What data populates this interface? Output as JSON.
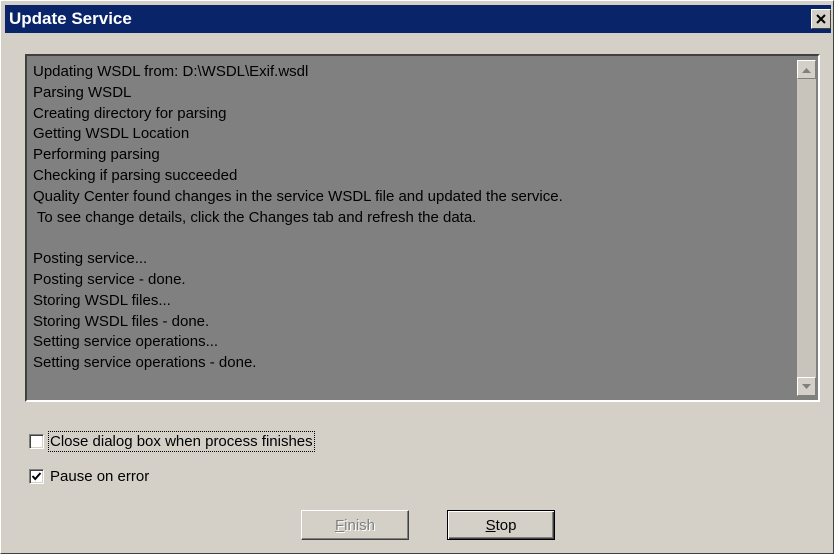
{
  "window": {
    "title": "Update Service",
    "close_icon": "close-icon"
  },
  "log": {
    "lines": [
      "Updating WSDL from: D:\\WSDL\\Exif.wsdl",
      "Parsing WSDL",
      "Creating directory for parsing",
      "Getting WSDL Location",
      "Performing parsing",
      "Checking if parsing succeeded",
      "Quality Center found changes in the service WSDL file and updated the service.",
      " To see change details, click the Changes tab and refresh the data.",
      "",
      "Posting service...",
      "Posting service - done.",
      "Storing WSDL files...",
      "Storing WSDL files - done.",
      "Setting service operations...",
      "Setting service operations - done."
    ]
  },
  "options": {
    "close_when_finished": {
      "label": "Close dialog box when process finishes",
      "checked": false
    },
    "pause_on_error": {
      "label": "Pause on error",
      "checked": true
    }
  },
  "buttons": {
    "finish": {
      "mnemonic": "F",
      "rest": "inish",
      "enabled": false
    },
    "stop": {
      "mnemonic": "S",
      "rest": "top",
      "enabled": true
    }
  },
  "colors": {
    "titlebar": "#0a246a",
    "dialog_face": "#d4d0c8",
    "log_background": "#808080"
  }
}
